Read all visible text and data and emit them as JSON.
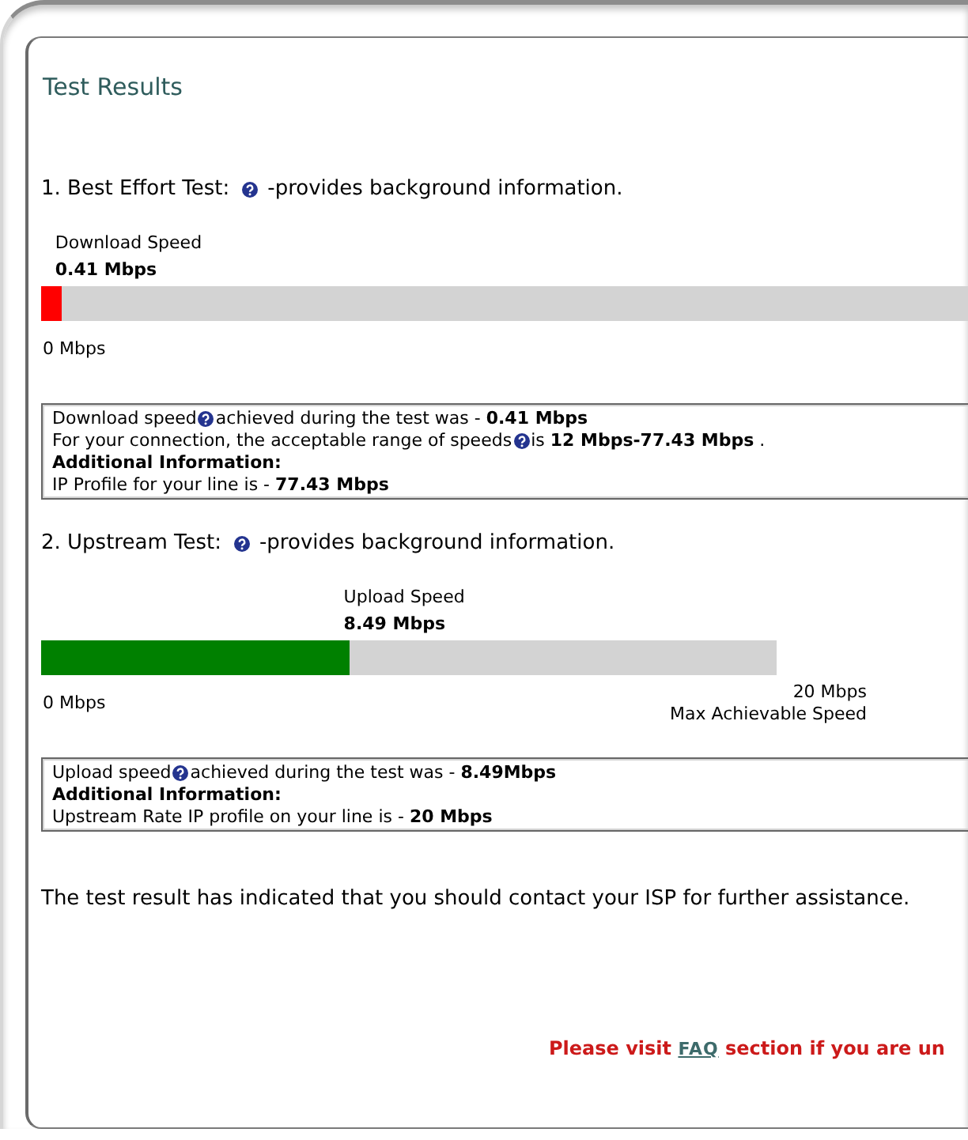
{
  "panel": {
    "title": "Test Results"
  },
  "tests": [
    {
      "title": "1. Best Effort Test:",
      "help_text": "-provides background information.",
      "meter": {
        "label": "Download Speed",
        "reading": "0.41 Mbps",
        "level": 0.022,
        "color": "#ff0000",
        "min_label": "0 Mbps"
      },
      "info": [
        {
          "kind": "text",
          "parts": [
            "Download speed",
            "achieved during the test was - **0.41 Mbps**"
          ]
        },
        {
          "kind": "text",
          "parts": [
            "For your connection, the acceptable range of speeds",
            "is **12 Mbps-77.43 Mbps** ."
          ]
        },
        {
          "kind": "heading",
          "parts": [
            "Additional Information:"
          ]
        },
        {
          "kind": "text",
          "parts": [
            "IP Profile for your line is - **77.43 Mbps**"
          ]
        }
      ]
    },
    {
      "title": "2. Upstream Test:",
      "help_text": "-provides background information.",
      "meter": {
        "label": "Upload Speed",
        "reading": "8.49 Mbps",
        "level": 0.42,
        "color": "#008000",
        "min_label": "0 Mbps",
        "max_label": "20 Mbps",
        "max_caption": "Max Achievable Speed"
      },
      "info": [
        {
          "kind": "text",
          "parts": [
            "Upload speed",
            "achieved during the test was - **8.49Mbps**"
          ]
        },
        {
          "kind": "heading",
          "parts": [
            "Additional Information:"
          ]
        },
        {
          "kind": "text",
          "parts": [
            "Upstream Rate IP profile on your line is - **20 Mbps**"
          ]
        }
      ]
    }
  ],
  "message": "The test result has indicated that you should contact your ISP for further assistance.",
  "notice": {
    "before": "Please visit",
    "link": "FAQ",
    "after": "section if you are un"
  }
}
